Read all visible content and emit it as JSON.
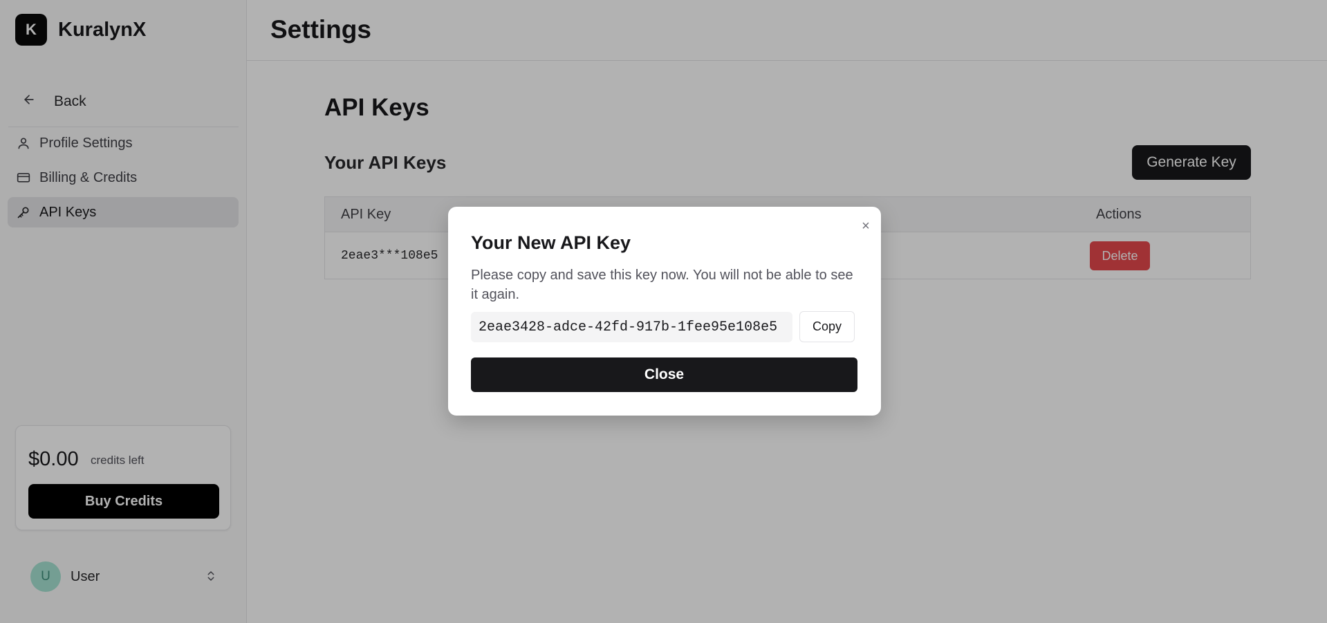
{
  "brand": {
    "logo_letter": "K",
    "name": "KuralynX"
  },
  "sidebar": {
    "back_label": "Back",
    "items": [
      {
        "label": "Profile Settings",
        "icon": "user-icon"
      },
      {
        "label": "Billing & Credits",
        "icon": "credit-card-icon"
      },
      {
        "label": "API Keys",
        "icon": "key-icon",
        "active": true
      }
    ],
    "credits": {
      "amount": "$0.00",
      "label": "credits left",
      "buy_label": "Buy Credits"
    },
    "user": {
      "initial": "U",
      "name": "User"
    }
  },
  "header": {
    "title": "Settings"
  },
  "main": {
    "section_title": "API Keys",
    "sub_title": "Your API Keys",
    "generate_label": "Generate Key",
    "table": {
      "columns": [
        "API Key",
        "Actions"
      ],
      "rows": [
        {
          "key": "2eae3***108e5",
          "action_label": "Delete"
        }
      ]
    }
  },
  "modal": {
    "close_x": "×",
    "title": "Your New API Key",
    "description": "Please copy and save this key now. You will not be able to see it again.",
    "key_value": "2eae3428-adce-42fd-917b-1fee95e108e5",
    "copy_label": "Copy",
    "close_label": "Close"
  },
  "colors": {
    "accent": "#18181b",
    "danger": "#e5484d",
    "avatar": "#a7e3d3"
  }
}
